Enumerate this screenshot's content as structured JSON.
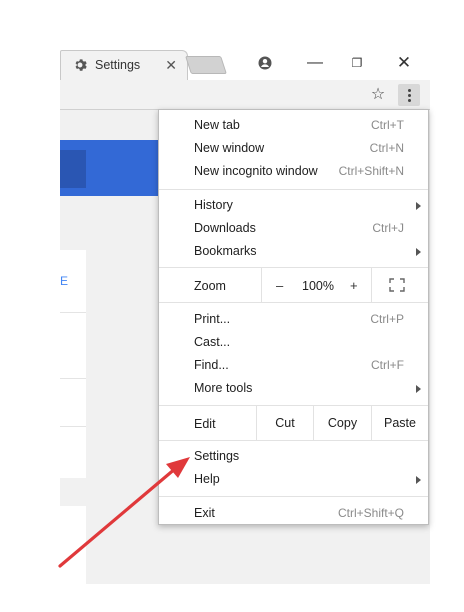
{
  "tab": {
    "title": "Settings",
    "close_glyph": "✕"
  },
  "window_controls": {
    "profile_icon": "account-icon",
    "minimize_glyph": "—",
    "maximize_glyph": "❐",
    "close_glyph": "✕"
  },
  "toolbar": {
    "star_glyph": "☆"
  },
  "page": {
    "link_text": "E",
    "accent_color": "#3369d6"
  },
  "menu": {
    "group1": [
      {
        "label": "New tab",
        "shortcut": "Ctrl+T"
      },
      {
        "label": "New window",
        "shortcut": "Ctrl+N"
      },
      {
        "label": "New incognito window",
        "shortcut": "Ctrl+Shift+N"
      }
    ],
    "group2": [
      {
        "label": "History",
        "shortcut": ""
      },
      {
        "label": "Downloads",
        "shortcut": "Ctrl+J"
      },
      {
        "label": "Bookmarks",
        "shortcut": ""
      }
    ],
    "zoom": {
      "label": "Zoom",
      "minus": "–",
      "value": "100%",
      "plus": "+"
    },
    "group3": [
      {
        "label": "Print...",
        "shortcut": "Ctrl+P"
      },
      {
        "label": "Cast...",
        "shortcut": ""
      },
      {
        "label": "Find...",
        "shortcut": "Ctrl+F"
      },
      {
        "label": "More tools",
        "shortcut": ""
      }
    ],
    "edit": {
      "label": "Edit",
      "cut": "Cut",
      "copy": "Copy",
      "paste": "Paste"
    },
    "group4": [
      {
        "label": "Settings",
        "shortcut": ""
      },
      {
        "label": "Help",
        "shortcut": ""
      }
    ],
    "exit": {
      "label": "Exit",
      "shortcut": "Ctrl+Shift+Q"
    }
  },
  "annotation": {
    "arrow_color": "#e0393b"
  }
}
